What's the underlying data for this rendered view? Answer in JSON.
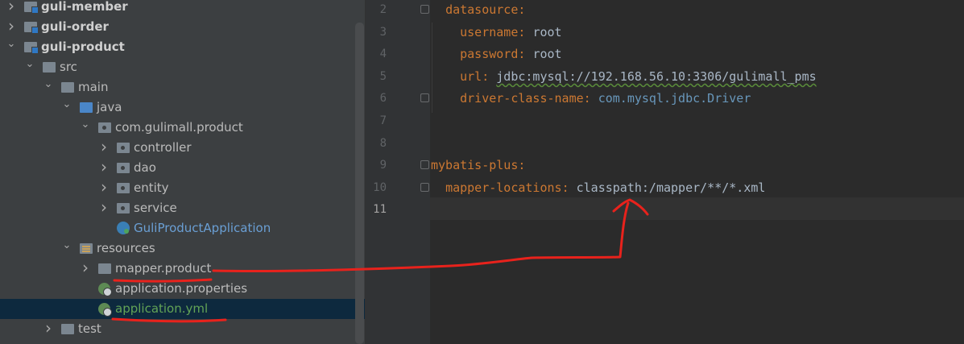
{
  "project_tree": {
    "items": [
      {
        "label": "guli-member",
        "level": 0,
        "expanded": false,
        "icon": "module-folder-icon",
        "bold": true
      },
      {
        "label": "guli-order",
        "level": 0,
        "expanded": false,
        "icon": "module-folder-icon",
        "bold": true
      },
      {
        "label": "guli-product",
        "level": 0,
        "expanded": true,
        "icon": "module-folder-icon",
        "bold": true
      },
      {
        "label": "src",
        "level": 1,
        "expanded": true,
        "icon": "folder-icon"
      },
      {
        "label": "main",
        "level": 2,
        "expanded": true,
        "icon": "folder-icon"
      },
      {
        "label": "java",
        "level": 3,
        "expanded": true,
        "icon": "source-folder-icon"
      },
      {
        "label": "com.gulimall.product",
        "level": 4,
        "expanded": true,
        "icon": "package-icon"
      },
      {
        "label": "controller",
        "level": 5,
        "expanded": false,
        "icon": "package-icon"
      },
      {
        "label": "dao",
        "level": 5,
        "expanded": false,
        "icon": "package-icon"
      },
      {
        "label": "entity",
        "level": 5,
        "expanded": false,
        "icon": "package-icon"
      },
      {
        "label": "service",
        "level": 5,
        "expanded": false,
        "icon": "package-icon"
      },
      {
        "label": "GuliProductApplication",
        "level": 5,
        "icon": "spring-boot-class-icon",
        "leaf": true,
        "color": "#6a9fd4"
      },
      {
        "label": "resources",
        "level": 3,
        "expanded": true,
        "icon": "resources-folder-icon"
      },
      {
        "label": "mapper.product",
        "level": 4,
        "expanded": false,
        "icon": "folder-icon"
      },
      {
        "label": "application.properties",
        "level": 4,
        "icon": "spring-config-icon",
        "leaf": true
      },
      {
        "label": "application.yml",
        "level": 4,
        "icon": "spring-config-icon",
        "leaf": true,
        "selected": true,
        "color": "#62a356"
      },
      {
        "label": "test",
        "level": 2,
        "expanded": false,
        "icon": "folder-icon"
      }
    ]
  },
  "editor": {
    "lines": [
      {
        "number": "2",
        "indent": "  ",
        "key": "datasource",
        "sep": ":",
        "value": "",
        "fold": true
      },
      {
        "number": "3",
        "indent": "    ",
        "key": "username",
        "sep": ": ",
        "value": "root"
      },
      {
        "number": "4",
        "indent": "    ",
        "key": "password",
        "sep": ": ",
        "value": "root"
      },
      {
        "number": "5",
        "indent": "    ",
        "key": "url",
        "sep": ": ",
        "value": "jdbc:mysql://192.168.56.10:3306/gulimall_pms",
        "underline": true
      },
      {
        "number": "6",
        "indent": "    ",
        "key": "driver-class-name",
        "sep": ": ",
        "value": "com.mysql.jdbc.Driver",
        "value_color": "#6897bb",
        "fold": true
      },
      {
        "number": "7",
        "indent": "",
        "key": "",
        "sep": "",
        "value": ""
      },
      {
        "number": "8",
        "indent": "",
        "key": "",
        "sep": "",
        "value": ""
      },
      {
        "number": "9",
        "indent": "",
        "key": "mybatis-plus",
        "sep": ":",
        "value": "",
        "fold": true
      },
      {
        "number": "10",
        "indent": "  ",
        "key": "mapper-locations",
        "sep": ": ",
        "value": "classpath:/mapper/**/*.xml",
        "fold": true
      },
      {
        "number": "11",
        "indent": "",
        "key": "",
        "sep": "",
        "value": "",
        "current": true
      }
    ]
  },
  "colors": {
    "tree_bg": "#3c3f41",
    "editor_bg": "#2b2b2b",
    "yaml_key": "#cc7832",
    "annotation_red": "#e8221c"
  }
}
